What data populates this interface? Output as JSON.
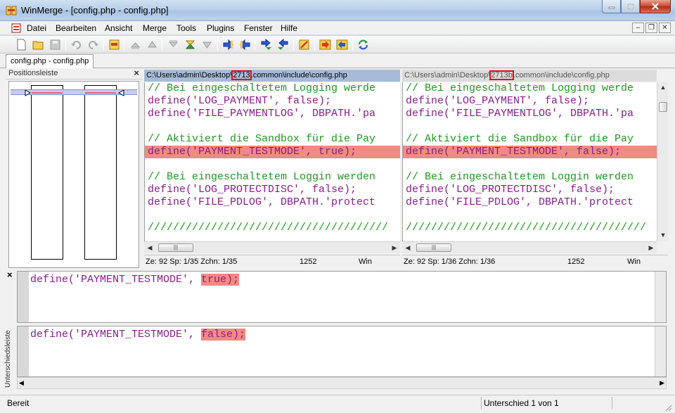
{
  "window": {
    "title": "WinMerge - [config.php - config.php]",
    "buttons": [
      "minimize",
      "maximize",
      "close"
    ]
  },
  "menubar": {
    "items": [
      "Datei",
      "Bearbeiten",
      "Ansicht",
      "Merge",
      "Tools",
      "Plugins",
      "Fenster",
      "Hilfe"
    ]
  },
  "toolbar": {
    "icons": [
      "new-icon",
      "open-icon",
      "save-icon",
      "undo-icon",
      "redo-icon",
      "options-icon",
      "first-diff-icon",
      "prev-diff-icon",
      "last-diff-icon",
      "current-diff-icon",
      "next-diff-icon",
      "copy-right-icon",
      "copy-left-icon",
      "copy-right-advance-icon",
      "copy-left-advance-icon",
      "all-right-icon",
      "edit-icon",
      "copy-all-right-icon",
      "copy-all-left-icon",
      "refresh-icon"
    ]
  },
  "tab": {
    "label": "config.php - config.php"
  },
  "location_pane": {
    "title": "Positionsleiste",
    "close": "×"
  },
  "left": {
    "path_prefix": "C:\\Users\\admin\\Desktop\\",
    "path_highlight": "2713",
    "path_suffix": ".common\\include\\config.php",
    "lines": [
      {
        "text": "// Bei eingeschaltetem Logging werde",
        "kind": "comment"
      },
      {
        "text": "define('LOG_PAYMENT', false);",
        "kind": "code"
      },
      {
        "text": "define('FILE_PAYMENTLOG', DBPATH.'pa",
        "kind": "code"
      },
      {
        "text": "",
        "kind": "blank"
      },
      {
        "text": "// Aktiviert die Sandbox für die Pay",
        "kind": "comment"
      },
      {
        "text": "define('PAYMENT_TESTMODE', true);",
        "kind": "diff"
      },
      {
        "text": "",
        "kind": "blank"
      },
      {
        "text": "// Bei eingeschaltetem Loggin werden",
        "kind": "comment"
      },
      {
        "text": "define('LOG_PROTECTDISC', false);",
        "kind": "code"
      },
      {
        "text": "define('FILE_PDLOG', DBPATH.'protect",
        "kind": "code"
      },
      {
        "text": "",
        "kind": "blank"
      },
      {
        "text": "//////////////////////////////////////",
        "kind": "comment"
      }
    ],
    "status": {
      "pos": "Ze: 92  Sp: 1/35  Zchn: 1/35",
      "codepage": "1252",
      "eol": "Win"
    }
  },
  "right": {
    "path_prefix": "C:\\Users\\admin\\Desktop\\",
    "path_highlight": "2713b",
    "path_suffix": ".common\\include\\config.php",
    "lines": [
      {
        "text": "// Bei eingeschaltetem Logging werde",
        "kind": "comment"
      },
      {
        "text": "define('LOG_PAYMENT', false);",
        "kind": "code"
      },
      {
        "text": "define('FILE_PAYMENTLOG', DBPATH.'pa",
        "kind": "code"
      },
      {
        "text": "",
        "kind": "blank"
      },
      {
        "text": "// Aktiviert die Sandbox für die Pay",
        "kind": "comment"
      },
      {
        "text": "define('PAYMENT_TESTMODE', false);",
        "kind": "diff"
      },
      {
        "text": "",
        "kind": "blank"
      },
      {
        "text": "// Bei eingeschaltetem Loggin werden",
        "kind": "comment"
      },
      {
        "text": "define('LOG_PROTECTDISC', false);",
        "kind": "code"
      },
      {
        "text": "define('FILE_PDLOG', DBPATH.'protect",
        "kind": "code"
      },
      {
        "text": "",
        "kind": "blank"
      },
      {
        "text": "//////////////////////////////////////",
        "kind": "comment"
      }
    ],
    "status": {
      "pos": "Ze: 92  Sp: 1/36  Zchn: 1/36",
      "codepage": "1252",
      "eol": "Win"
    }
  },
  "diff_pane": {
    "label": "Unterschiedsleiste",
    "close": "×",
    "top_prefix": "define('PAYMENT_TESTMODE', ",
    "top_highlight": "true);",
    "bottom_prefix": "define('PAYMENT_TESTMODE', ",
    "bottom_highlight": "false);"
  },
  "statusbar": {
    "left": "Bereit",
    "right": "Unterschied 1 von 1"
  },
  "colors": {
    "diff": "#f08a82",
    "comment": "#1e9a1e",
    "keyword": "#8a1e8a",
    "path_active": "#a6bbd8"
  }
}
